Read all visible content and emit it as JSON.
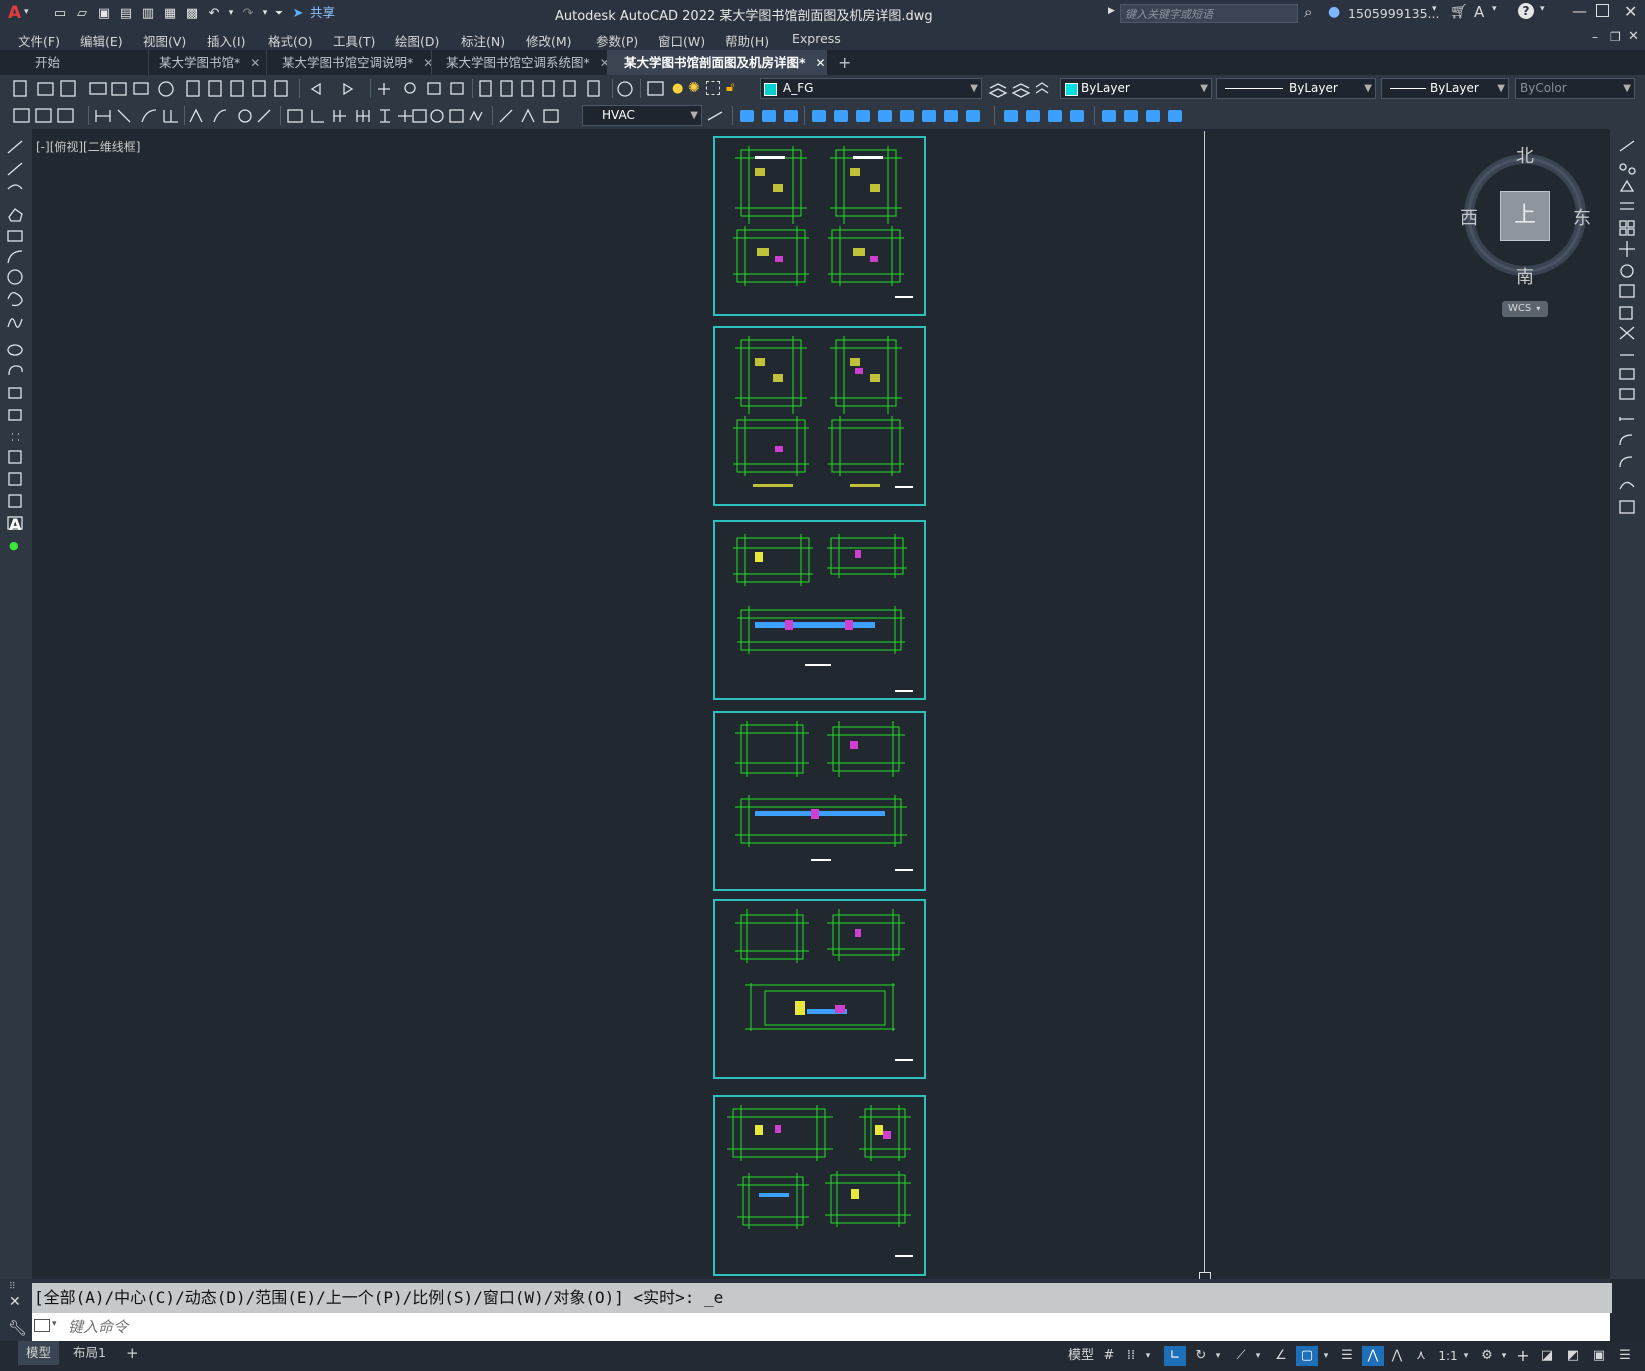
{
  "title_bar": {
    "app_title": "Autodesk AutoCAD 2022    某大学图书馆剖面图及机房详图.dwg",
    "share_label": "共享",
    "search_placeholder": "键入关键字或短语",
    "user_name": "1505999135...",
    "app_logo": "A"
  },
  "menu": {
    "items": [
      "文件(F)",
      "编辑(E)",
      "视图(V)",
      "插入(I)",
      "格式(O)",
      "工具(T)",
      "绘图(D)",
      "标注(N)",
      "修改(M)",
      "参数(P)",
      "窗口(W)",
      "帮助(H)",
      "Express"
    ]
  },
  "tabs": {
    "start": "开始",
    "items": [
      {
        "label": "某大学图书馆*"
      },
      {
        "label": "某大学图书馆空调说明*"
      },
      {
        "label": "某大学图书馆空调系统图*"
      },
      {
        "label": "某大学图书馆剖面图及机房详图*"
      }
    ],
    "add": "+"
  },
  "toolbar": {
    "layer_name": "A_FG",
    "color_value": "ByLayer",
    "linetype_value": "ByLayer",
    "lineweight_value": "ByLayer",
    "plotstyle_value": "ByColor",
    "dimstyle_value": "HVAC",
    "layer_color": "#00d0d0",
    "color_swatch": "#00e0e0"
  },
  "viewport": {
    "label": "[-][俯视][二维线框]"
  },
  "viewcube": {
    "north": "北",
    "south": "南",
    "east": "东",
    "west": "西",
    "top": "上",
    "wcs": "WCS"
  },
  "command": {
    "history": "[全部(A)/中心(C)/动态(D)/范围(E)/上一个(P)/比例(S)/窗口(W)/对象(O)] <实时>: _e",
    "placeholder": "键入命令"
  },
  "status": {
    "model_tab": "模型",
    "layout_tab": "布局1",
    "add_tab": "+",
    "model_label": "模型",
    "scale": "1:1"
  },
  "colors": {
    "sheet_border": "#2fbfbf",
    "drawing_green": "#22e022",
    "accent_blue": "#1d6fb8"
  }
}
